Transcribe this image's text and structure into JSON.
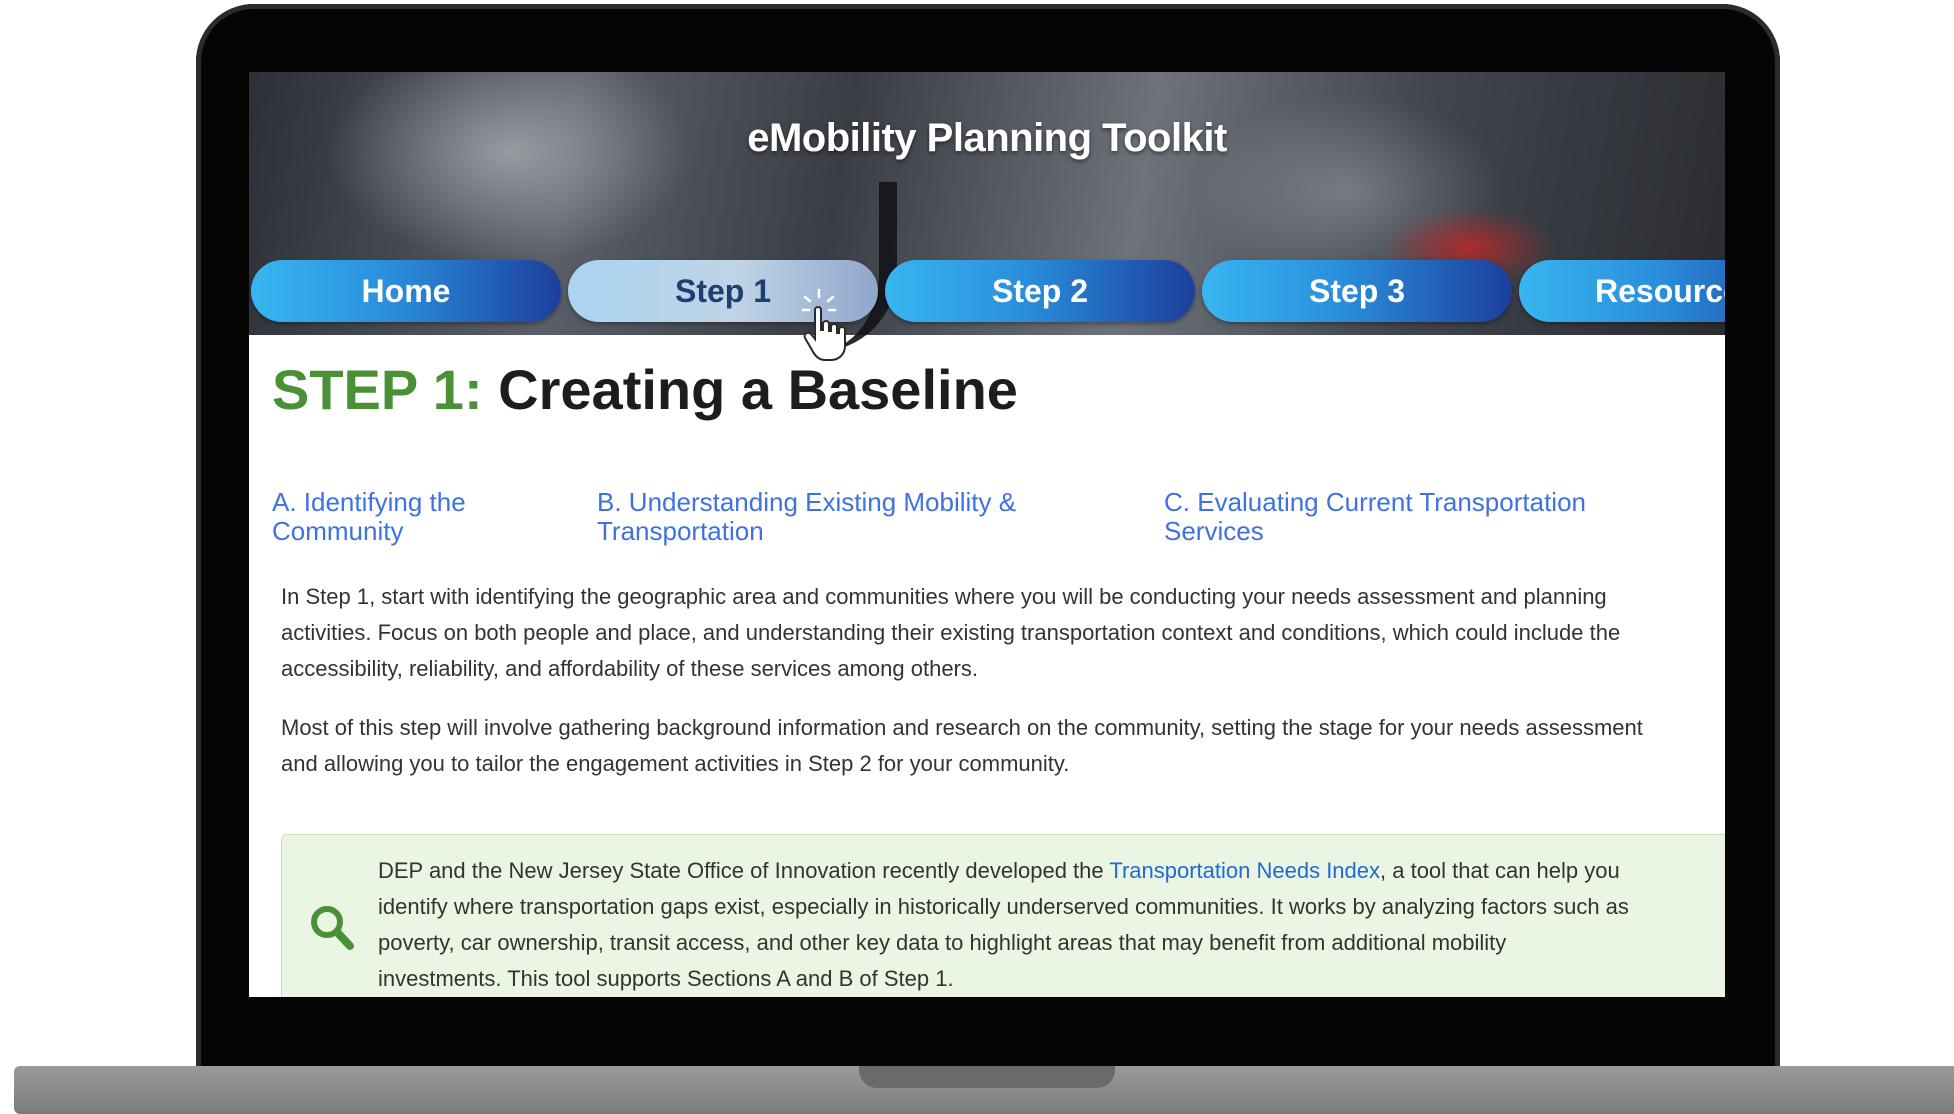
{
  "app": {
    "title": "eMobility Planning Toolkit"
  },
  "nav": {
    "items": [
      {
        "label": "Home",
        "active": false
      },
      {
        "label": "Step 1",
        "active": true
      },
      {
        "label": "Step 2",
        "active": false
      },
      {
        "label": "Step 3",
        "active": false
      },
      {
        "label": "Resources",
        "active": false
      }
    ]
  },
  "page": {
    "step_prefix": "STEP 1:",
    "step_title": "Creating a Baseline",
    "subnav": {
      "a_line1": "A. Identifying the",
      "a_line2": "Community",
      "b_line1": "B. Understanding Existing Mobility &",
      "b_line2": "Transportation",
      "c_line1": "C. Evaluating Current Transportation",
      "c_line2": "Services"
    },
    "paragraph1": {
      "line1": "In Step 1, start with identifying the geographic area and communities where you will be conducting your needs assessment and planning",
      "line2": "activities. Focus on both people and place, and understanding their existing transportation context and conditions, which could include the",
      "line3": "accessibility, reliability, and affordability of these services among others."
    },
    "paragraph2": {
      "line1": "Most of this step will involve gathering background information and research on the community, setting the stage for your needs assessment",
      "line2": "and allowing you to tailor the engagement activities in Step 2 for your community."
    },
    "callout": {
      "line1_before": "DEP and the New Jersey State Office of Innovation recently developed the ",
      "link_text": "Transportation Needs Index",
      "line1_after": ", a tool that can help you",
      "line2": "identify where transportation gaps exist, especially in historically underserved communities. It works by analyzing factors such as",
      "line3": "poverty, car ownership, transit access, and other key data to highlight areas that may benefit from additional mobility",
      "line4": "investments. This tool supports Sections A and B of Step 1."
    }
  },
  "colors": {
    "step_prefix": "#4a9136",
    "link": "#3d72e0",
    "callout_bg": "#eaf5e4",
    "nav_gradient_start": "#38b6f0",
    "nav_gradient_end": "#1c3f9c"
  },
  "icons": {
    "callout": "search-icon",
    "cursor": "pointer-hand-icon"
  }
}
